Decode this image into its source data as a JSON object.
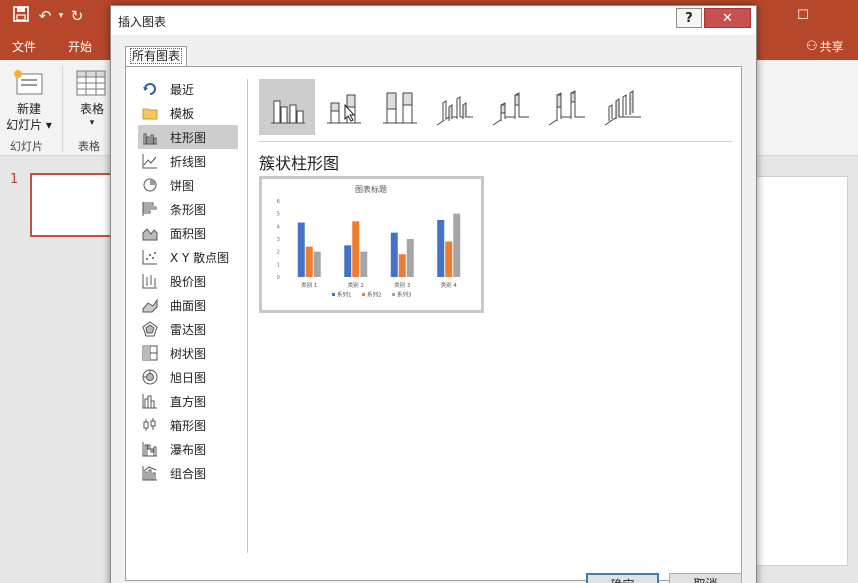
{
  "ppt": {
    "tabs": [
      "文件",
      "开始"
    ],
    "share": "共享",
    "new_slide": "新建\n幻灯片",
    "new_slide_line1": "新建",
    "new_slide_line2": "幻灯片",
    "table_btn": "表格",
    "group_slides": "幻灯片",
    "group_table": "表格",
    "slide_number": "1",
    "colors": {
      "accent": "#b7472a"
    }
  },
  "dialog": {
    "title": "插入图表",
    "help": "?",
    "tab_all": "所有图表",
    "chart_types": [
      {
        "label": "最近",
        "icon": "recent-icon"
      },
      {
        "label": "模板",
        "icon": "folder-icon"
      },
      {
        "label": "柱形图",
        "icon": "column-chart-icon",
        "selected": true
      },
      {
        "label": "折线图",
        "icon": "line-chart-icon"
      },
      {
        "label": "饼图",
        "icon": "pie-chart-icon"
      },
      {
        "label": "条形图",
        "icon": "bar-chart-icon"
      },
      {
        "label": "面积图",
        "icon": "area-chart-icon"
      },
      {
        "label": "X Y 散点图",
        "icon": "scatter-chart-icon"
      },
      {
        "label": "股价图",
        "icon": "stock-chart-icon"
      },
      {
        "label": "曲面图",
        "icon": "surface-chart-icon"
      },
      {
        "label": "雷达图",
        "icon": "radar-chart-icon"
      },
      {
        "label": "树状图",
        "icon": "treemap-chart-icon"
      },
      {
        "label": "旭日图",
        "icon": "sunburst-chart-icon"
      },
      {
        "label": "直方图",
        "icon": "histogram-chart-icon"
      },
      {
        "label": "箱形图",
        "icon": "box-chart-icon"
      },
      {
        "label": "瀑布图",
        "icon": "waterfall-chart-icon"
      },
      {
        "label": "组合图",
        "icon": "combo-chart-icon"
      }
    ],
    "subtype_heading": "簇状柱形图",
    "ok": "确定",
    "cancel": "取消"
  },
  "chart_data": {
    "type": "bar",
    "title": "图表标题",
    "categories": [
      "类别 1",
      "类别 2",
      "类别 3",
      "类别 4"
    ],
    "series": [
      {
        "name": "系列1",
        "values": [
          4.3,
          2.5,
          3.5,
          4.5
        ],
        "color": "#4472c4"
      },
      {
        "name": "系列2",
        "values": [
          2.4,
          4.4,
          1.8,
          2.8
        ],
        "color": "#ed7d31"
      },
      {
        "name": "系列3",
        "values": [
          2,
          2,
          3,
          5
        ],
        "color": "#a5a5a5"
      }
    ],
    "ylim": [
      0,
      6
    ],
    "yticks": [
      "0",
      "1",
      "2",
      "3",
      "4",
      "5",
      "6"
    ],
    "legend": "bottom"
  }
}
